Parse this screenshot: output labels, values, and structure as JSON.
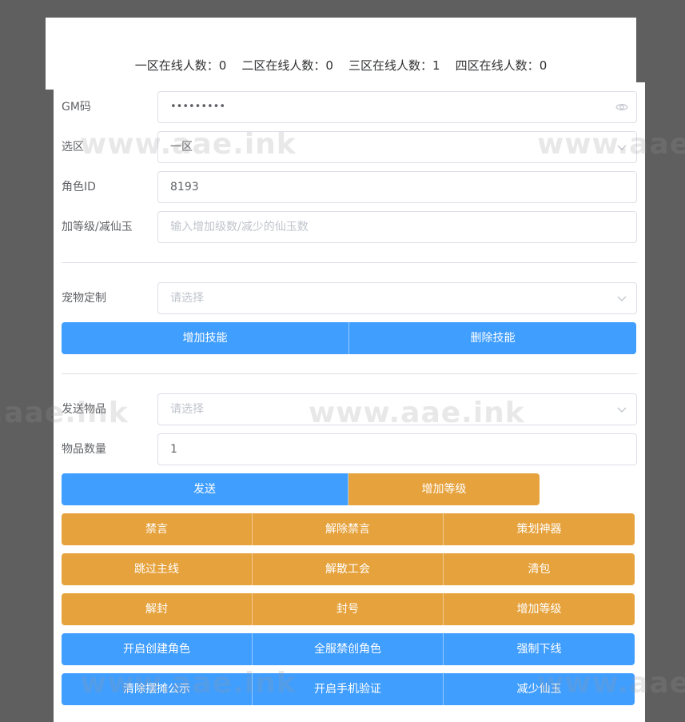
{
  "online": {
    "zone1_label": "一区在线人数：",
    "zone1_count": "0",
    "zone2_label": "二区在线人数：",
    "zone2_count": "0",
    "zone3_label": "三区在线人数：",
    "zone3_count": "1",
    "zone4_label": "四区在线人数：",
    "zone4_count": "0"
  },
  "form": {
    "gm_code": {
      "label": "GM码",
      "value": "•••••••••"
    },
    "zone": {
      "label": "选区",
      "value": "一区"
    },
    "role_id": {
      "label": "角色ID",
      "value": "8193"
    },
    "level_jade": {
      "label": "加等级/减仙玉",
      "placeholder": "输入增加级数/减少的仙玉数"
    },
    "pet": {
      "label": "宠物定制",
      "placeholder": "请选择"
    },
    "send_item": {
      "label": "发送物品",
      "placeholder": "请选择"
    },
    "item_qty": {
      "label": "物品数量",
      "value": "1"
    }
  },
  "buttons": {
    "add_skill": "增加技能",
    "remove_skill": "删除技能",
    "send": "发送",
    "add_level": "增加等级",
    "mute": "禁言",
    "unmute": "解除禁言",
    "planner_artifact": "策划神器",
    "skip_main_quest": "跳过主线",
    "disband_guild": "解散工会",
    "clear_bag": "清包",
    "unban": "解封",
    "ban": "封号",
    "add_level_2": "增加等级",
    "enable_create_role": "开启创建角色",
    "server_ban_create_role": "全服禁创角色",
    "force_offline": "强制下线",
    "clear_stall_notice": "清除摆摊公示",
    "enable_phone_verify": "开启手机验证",
    "reduce_jade": "减少仙玉"
  },
  "watermark_text": "www.aae.ink",
  "colors": {
    "primary": "#409eff",
    "warning": "#e6a23c",
    "background": "#5f5f5f"
  },
  "icons": {
    "password_toggle": "eye-icon",
    "select_arrow": "chevron-down-icon"
  }
}
